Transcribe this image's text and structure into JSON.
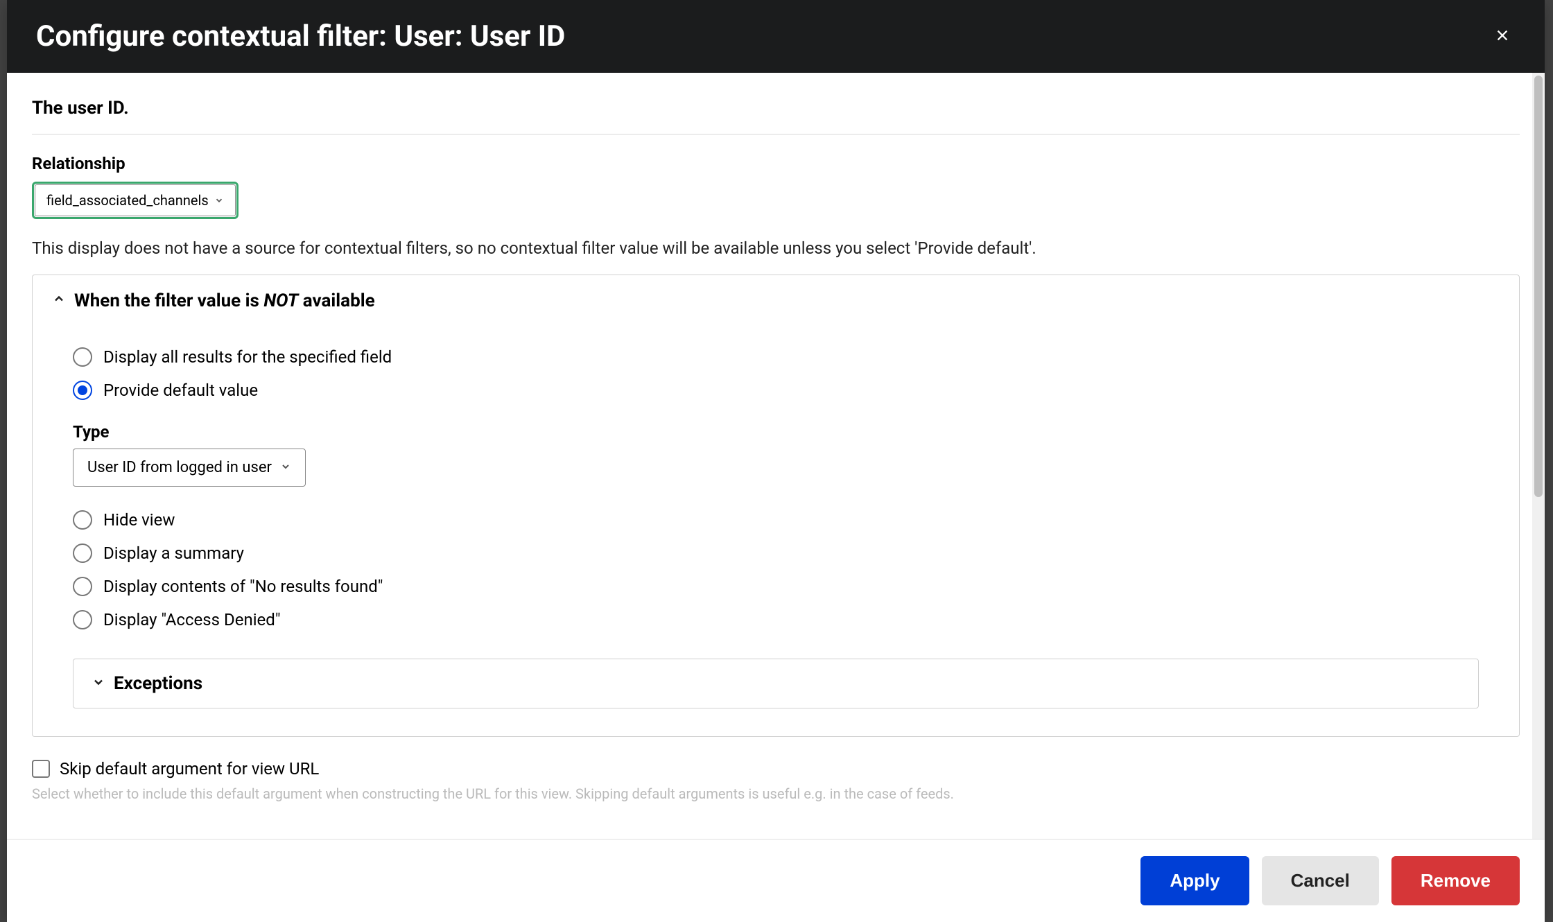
{
  "header": {
    "title": "Configure contextual filter: User: User ID"
  },
  "legend": "The user ID.",
  "relationship": {
    "label": "Relationship",
    "value": "field_associated_channels"
  },
  "info": "This display does not have a source for contextual filters, so no contextual filter value will be available unless you select 'Provide default'.",
  "when_not_available": {
    "title_prefix": "When the filter value is ",
    "title_not": "NOT",
    "title_suffix": " available",
    "options": [
      "Display all results for the specified field",
      "Provide default value",
      "Hide view",
      "Display a summary",
      "Display contents of \"No results found\"",
      "Display \"Access Denied\""
    ],
    "selected_index": 1,
    "type_label": "Type",
    "type_value": "User ID from logged in user"
  },
  "exceptions": {
    "title": "Exceptions"
  },
  "skip_default": {
    "label": "Skip default argument for view URL",
    "hint": "Select whether to include this default argument when constructing the URL for this view. Skipping default arguments is useful e.g. in the case of feeds."
  },
  "footer": {
    "apply": "Apply",
    "cancel": "Cancel",
    "remove": "Remove"
  }
}
